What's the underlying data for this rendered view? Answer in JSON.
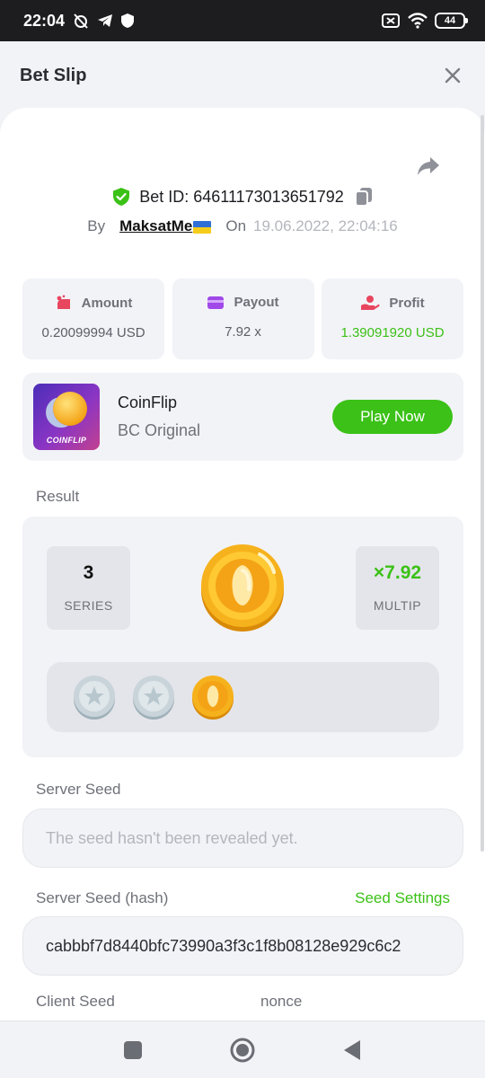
{
  "status_bar": {
    "time": "22:04",
    "battery": "44"
  },
  "header": {
    "title": "Bet Slip"
  },
  "bet": {
    "id_label": "Bet ID: 64611173013651792",
    "by_label": "By",
    "username": "MaksatMe",
    "on_label": "On",
    "date": "19.06.2022, 22:04:16"
  },
  "stats": [
    {
      "label": "Amount",
      "value": "0.20099994 USD",
      "icon": "coins-icon"
    },
    {
      "label": "Payout",
      "value": "7.92 x",
      "icon": "card-icon"
    },
    {
      "label": "Profit",
      "value": "1.39091920 USD",
      "icon": "hand-coin-icon"
    }
  ],
  "game": {
    "thumb_label": "COINFLIP",
    "name": "CoinFlip",
    "provider": "BC Original",
    "play_label": "Play Now"
  },
  "result": {
    "section_label": "Result",
    "series_value": "3",
    "series_label": "SERIES",
    "multip_value": "×7.92",
    "multip_label": "MULTIP"
  },
  "server_seed": {
    "label": "Server Seed",
    "placeholder": "The seed hasn't been revealed yet."
  },
  "server_seed_hash": {
    "label": "Server Seed (hash)",
    "settings_label": "Seed Settings",
    "value": "cabbbf7d8440bfc73990a3f3c1f8b08128e929c6c2"
  },
  "client_seed": {
    "label": "Client Seed",
    "nonce_label": "nonce"
  },
  "colors": {
    "accent_green": "#3bc117",
    "coin_gold": "#f4a316",
    "coin_silver": "#c9d4da"
  }
}
